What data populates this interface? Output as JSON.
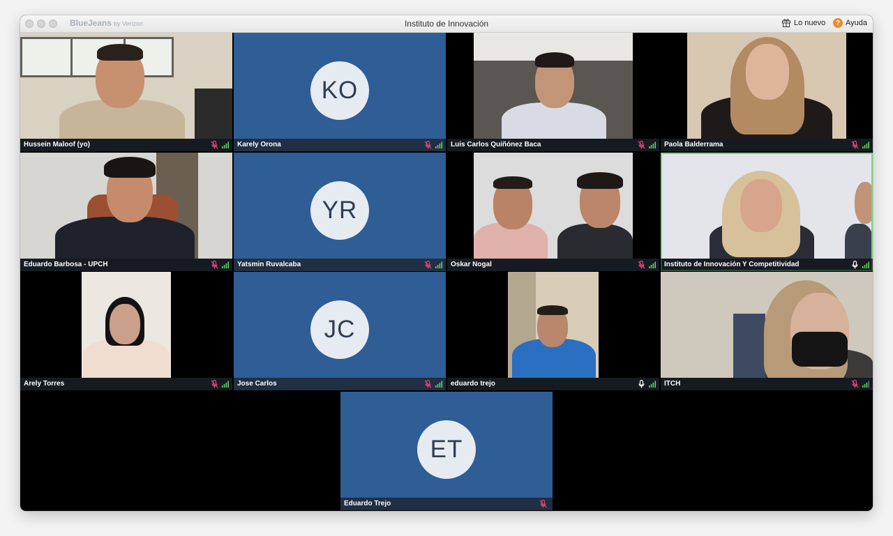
{
  "window": {
    "brand": "BlueJeans",
    "brand_sub": "by Verizon",
    "title": "Instituto de Innovación",
    "whats_new": "Lo nuevo",
    "help": "Ayuda",
    "help_icon_glyph": "?"
  },
  "tiles": [
    {
      "name": "Hussein Maloof (yo)",
      "type": "video",
      "mic": "muted"
    },
    {
      "name": "Karely Orona",
      "type": "avatar",
      "initials": "KO",
      "mic": "muted"
    },
    {
      "name": "Luis Carlos Quiñónez Baca",
      "type": "video",
      "mic": "muted"
    },
    {
      "name": "Paola Balderrama",
      "type": "video",
      "mic": "muted"
    },
    {
      "name": "Eduardo Barbosa - UPCH",
      "type": "video",
      "mic": "muted"
    },
    {
      "name": "Yatsmin Ruvalcaba",
      "type": "avatar",
      "initials": "YR",
      "mic": "muted"
    },
    {
      "name": "Oskar Nogal",
      "type": "video",
      "mic": "muted"
    },
    {
      "name": "Instituto de Innovación Y Competitividad",
      "type": "video",
      "mic": "on",
      "active_speaker": true
    },
    {
      "name": "Arely Torres",
      "type": "video",
      "mic": "muted"
    },
    {
      "name": "Jose Carlos",
      "type": "avatar",
      "initials": "JC",
      "mic": "muted"
    },
    {
      "name": "eduardo trejo",
      "type": "video",
      "mic": "on"
    },
    {
      "name": "ITCH",
      "type": "video",
      "mic": "muted"
    },
    {
      "name": "Eduardo Trejo",
      "type": "avatar",
      "initials": "ET",
      "mic": "muted"
    }
  ],
  "icons": {
    "muted": "mic-muted-icon",
    "on": "mic-icon",
    "signal": "signal-bars-icon",
    "gift": "gift-icon",
    "help": "help-icon"
  },
  "colors": {
    "avatar_bg": "#2f5d95",
    "muted_mic": "#e2447a",
    "signal": "#5fd35f",
    "active_border": "#77d67d",
    "help_badge": "#f08a24"
  }
}
